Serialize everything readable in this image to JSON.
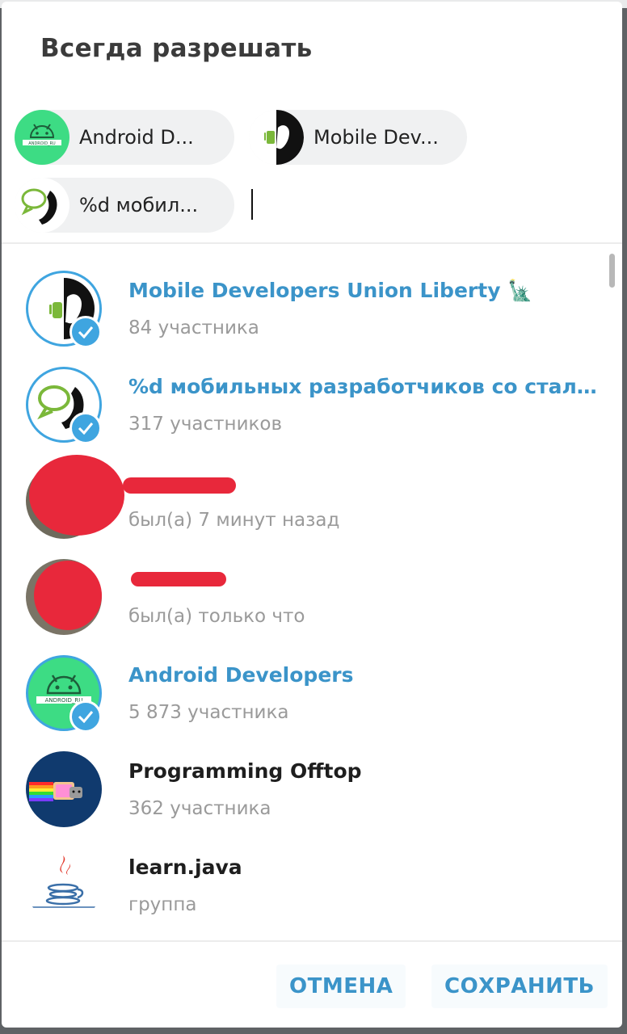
{
  "dialog": {
    "title": "Всегда разрешать"
  },
  "chips": [
    {
      "label": "Android D...",
      "avatar_icon": "android-ru-icon"
    },
    {
      "label": "Mobile Dev...",
      "avatar_icon": "mobile-developers-icon"
    },
    {
      "label": "%d мобил...",
      "avatar_icon": "chat-phone-icon"
    }
  ],
  "list": [
    {
      "name": "Mobile Developers Union Liberty",
      "emoji": "🗽",
      "status": "84 участника",
      "verified": true,
      "name_color": "blue"
    },
    {
      "name": "%d мобильных разработчиков со сталь...",
      "status": "317 участников",
      "verified": true,
      "name_color": "blue"
    },
    {
      "name": "",
      "status": "был(а) 7 минут назад",
      "verified": false,
      "name_color": "black"
    },
    {
      "name": "",
      "status": "был(а) только что",
      "verified": false,
      "name_color": "black"
    },
    {
      "name": "Android Developers",
      "status": "5 873 участника",
      "verified": true,
      "name_color": "blue"
    },
    {
      "name": "Programming Offtop",
      "status": "362 участника",
      "verified": false,
      "name_color": "black"
    },
    {
      "name": "learn.java",
      "status": "группа",
      "verified": false,
      "name_color": "black"
    }
  ],
  "buttons": {
    "cancel": "ОТМЕНА",
    "save": "СОХРАНИТЬ"
  },
  "colors": {
    "accent": "#3b94c9",
    "verified": "#3fa5e0",
    "android_green": "#3ddc84",
    "redaction": "#e8283b"
  }
}
